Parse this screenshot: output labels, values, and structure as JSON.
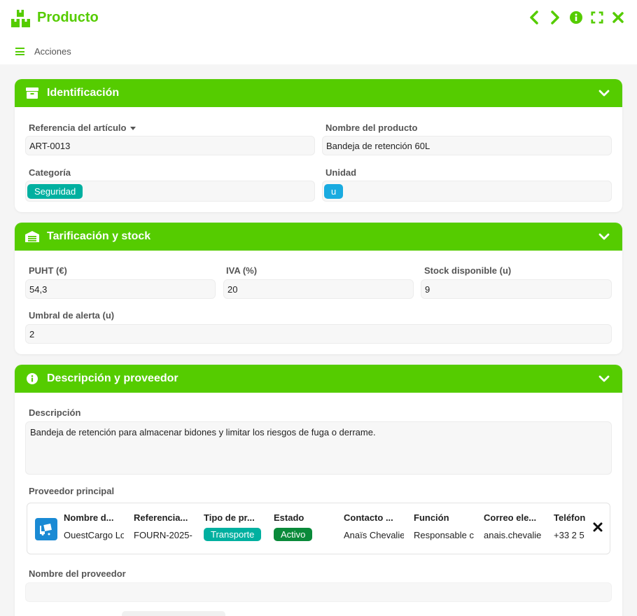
{
  "window": {
    "title": "Producto",
    "actions_label": "Acciones"
  },
  "identificacion": {
    "title": "Identificación",
    "ref_label": "Referencia del artículo",
    "ref_value": "ART-0013",
    "name_label": "Nombre del producto",
    "name_value": "Bandeja de retención 60L",
    "category_label": "Categoría",
    "category_value": "Seguridad",
    "unit_label": "Unidad",
    "unit_value": "u"
  },
  "tarificacion": {
    "title": "Tarificación y stock",
    "puht_label": "PUHT (€)",
    "puht_value": "54,3",
    "iva_label": "IVA (%)",
    "iva_value": "20",
    "stock_label": "Stock disponible (u)",
    "stock_value": "9",
    "umbral_label": "Umbral de alerta (u)",
    "umbral_value": "2"
  },
  "descripcion": {
    "title": "Descripción y proveedor",
    "desc_label": "Descripción",
    "desc_value": "Bandeja de retención para almacenar bidones y limitar los riesgos de fuga o derrame.",
    "supplier_label": "Proveedor principal",
    "supplier_name_label": "Nombre del proveedor",
    "supplier": {
      "columns": [
        {
          "header": "Nombre d...",
          "value": "OuestCargo Lo"
        },
        {
          "header": "Referencia...",
          "value": "FOURN-2025-"
        },
        {
          "header": "Tipo de pr...",
          "value": "Transporte"
        },
        {
          "header": "Estado",
          "value": "Activo"
        },
        {
          "header": "Contacto ...",
          "value": "Anaïs Chevalie"
        },
        {
          "header": "Función",
          "value": "Responsable c"
        },
        {
          "header": "Correo ele...",
          "value": "anais.chevalie"
        },
        {
          "header": "Teléfon",
          "value": "+33 2 5"
        }
      ]
    }
  },
  "colors": {
    "accent": "#55cc00",
    "teal_tag": "#00b0a0",
    "blue_tag": "#1aabe0",
    "status_active": "#0a8a3a",
    "supplier_icon": "#1a8ad4"
  }
}
